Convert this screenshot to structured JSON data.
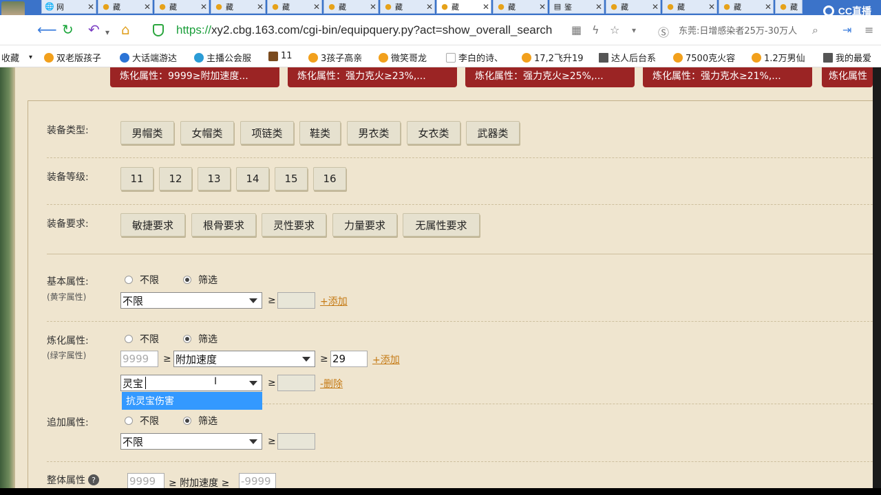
{
  "browser": {
    "tabs": [
      {
        "label": "网"
      },
      {
        "label": "藏"
      },
      {
        "label": "藏"
      },
      {
        "label": "藏"
      },
      {
        "label": "藏"
      },
      {
        "label": "藏"
      },
      {
        "label": "藏"
      },
      {
        "label": "藏"
      },
      {
        "label": "藏"
      },
      {
        "label": "鉴"
      },
      {
        "label": "藏"
      },
      {
        "label": "藏"
      },
      {
        "label": "藏"
      },
      {
        "label": "藏"
      }
    ],
    "brand": "CC直播",
    "url_scheme": "https://",
    "url_rest": "xy2.cbg.163.com/cgi-bin/equipquery.py?act=show_overall_search",
    "news": "东莞:日增感染者25万-30万人",
    "bookmarks": [
      "收藏",
      "双老版孩子",
      "大话端游达",
      "主播公会服",
      "11",
      "3孩子高亲",
      "微笑哥龙",
      "李白的诗、",
      "17,2飞升19",
      "达人后台系",
      "7500克火容",
      "1.2万男仙",
      "我的最爱"
    ]
  },
  "refine_buttons": [
    "炼化属性：9999≥附加速度...",
    "炼化属性：强力克火≥23%,...",
    "炼化属性：强力克火≥25%,...",
    "炼化属性：强力克水≥21%,...",
    "炼化属性"
  ],
  "equip_type": {
    "label": "装备类型:",
    "options": [
      "男帽类",
      "女帽类",
      "项链类",
      "鞋类",
      "男衣类",
      "女衣类",
      "武器类"
    ]
  },
  "equip_level": {
    "label": "装备等级:",
    "options": [
      "11",
      "12",
      "13",
      "14",
      "15",
      "16"
    ]
  },
  "equip_req": {
    "label": "装备要求:",
    "options": [
      "敏捷要求",
      "根骨要求",
      "灵性要求",
      "力量要求",
      "无属性要求"
    ]
  },
  "basic": {
    "label": "基本属性:",
    "sub": "(黄字属性)",
    "radio_any": "不限",
    "radio_filter": "筛选",
    "select_value": "不限",
    "ge": "≥",
    "value": "",
    "add": "+添加"
  },
  "refine": {
    "label": "炼化属性:",
    "sub": "(绿字属性)",
    "radio_any": "不限",
    "radio_filter": "筛选",
    "row1_left_placeholder": "9999",
    "row1_select": "附加速度",
    "row1_value": "29",
    "add": "+添加",
    "row2_select_text": "灵宝",
    "row2_value": "",
    "delete": "-删除",
    "dropdown_option": "抗灵宝伤害",
    "ge": "≥",
    "cursor": "I"
  },
  "extra": {
    "label": "追加属性:",
    "radio_any": "不限",
    "radio_filter": "筛选",
    "select_value": "不限",
    "ge": "≥",
    "value": ""
  },
  "overall": {
    "label": "整体属性",
    "help": "?",
    "left_placeholder": "9999",
    "middle": "≥ 附加速度 ≥",
    "right_placeholder": "-9999"
  }
}
